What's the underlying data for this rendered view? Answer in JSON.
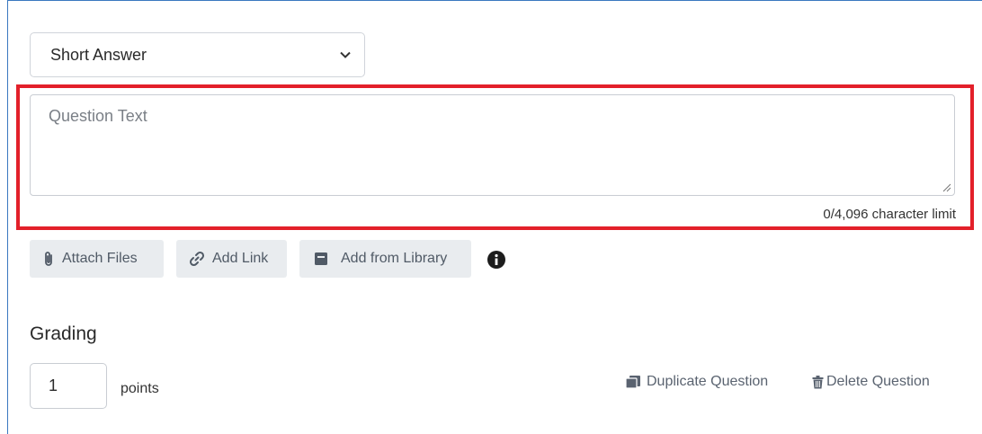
{
  "question_type": {
    "selected": "Short Answer"
  },
  "question_text": {
    "placeholder": "Question Text",
    "char_limit": "0/4,096 character limit"
  },
  "toolbar": {
    "attach_files": "Attach Files",
    "add_link": "Add Link",
    "add_from_library": "Add from Library"
  },
  "grading": {
    "title": "Grading",
    "points_value": "1",
    "points_label": "points"
  },
  "actions": {
    "duplicate": "Duplicate Question",
    "delete": "Delete Question"
  },
  "colors": {
    "highlight": "#e3202a",
    "button_bg": "#e9ecef",
    "frame": "#3a78c0"
  }
}
